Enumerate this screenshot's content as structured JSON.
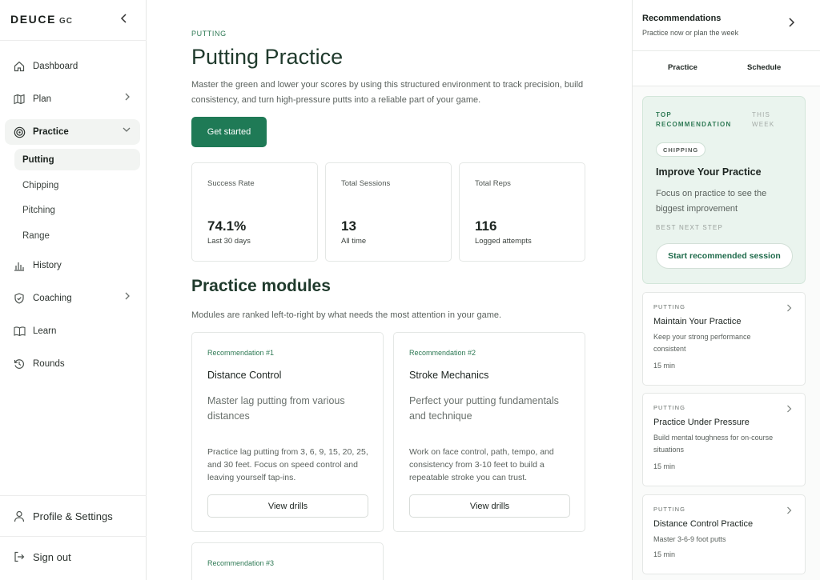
{
  "brand": {
    "name": "DEUCE",
    "suffix": "GC"
  },
  "sidebar": {
    "items": [
      {
        "label": "Dashboard"
      },
      {
        "label": "Plan"
      },
      {
        "label": "Practice"
      },
      {
        "label": "History"
      },
      {
        "label": "Coaching"
      },
      {
        "label": "Learn"
      },
      {
        "label": "Rounds"
      }
    ],
    "practice_sub": [
      {
        "label": "Putting"
      },
      {
        "label": "Chipping"
      },
      {
        "label": "Pitching"
      },
      {
        "label": "Range"
      }
    ],
    "profile": "Profile & Settings",
    "signout": "Sign out"
  },
  "main": {
    "eyebrow": "PUTTING",
    "title": "Putting Practice",
    "description": "Master the green and lower your scores by using this structured environment to track precision, build consistency, and turn high-pressure putts into a reliable part of your game.",
    "cta": "Get started",
    "stats": [
      {
        "label": "Success Rate",
        "value": "74.1%",
        "note": "Last 30 days"
      },
      {
        "label": "Total Sessions",
        "value": "13",
        "note": "All time"
      },
      {
        "label": "Total Reps",
        "value": "116",
        "note": "Logged attempts"
      }
    ],
    "modules_title": "Practice modules",
    "modules_desc": "Modules are ranked left-to-right by what needs the most attention in your game.",
    "modules": [
      {
        "rec": "Recommendation #1",
        "title": "Distance Control",
        "subtitle": "Master lag putting from various distances",
        "description": "Practice lag putting from 3, 6, 9, 15, 20, 25, and 30 feet. Focus on speed control and leaving yourself tap-ins.",
        "button": "View drills"
      },
      {
        "rec": "Recommendation #2",
        "title": "Stroke Mechanics",
        "subtitle": "Perfect your putting fundamentals and technique",
        "description": "Work on face control, path, tempo, and consistency from 3-10 feet to build a repeatable stroke you can trust.",
        "button": "View drills"
      },
      {
        "rec": "Recommendation #3"
      }
    ]
  },
  "right": {
    "title": "Recommendations",
    "subtitle": "Practice now or plan the week",
    "tabs": [
      "Practice",
      "Schedule"
    ],
    "top": {
      "label": "TOP RECOMMENDATION",
      "week": "THIS WEEK",
      "chip": "CHIPPING",
      "title": "Improve Your Practice",
      "description": "Focus on practice to see the biggest improvement",
      "next": "BEST NEXT STEP",
      "button": "Start recommended session"
    },
    "cards": [
      {
        "category": "PUTTING",
        "title": "Maintain Your Practice",
        "description": "Keep your strong performance consistent",
        "time": "15 min"
      },
      {
        "category": "PUTTING",
        "title": "Practice Under Pressure",
        "description": "Build mental toughness for on-course situations",
        "time": "15 min"
      },
      {
        "category": "PUTTING",
        "title": "Distance Control Practice",
        "description": "Master 3-6-9 foot putts",
        "time": "15 min"
      }
    ]
  },
  "colors": {
    "accent": "#1f7a56",
    "accent_text": "#2f7a55",
    "top_card_bg": "#eaf4ee"
  }
}
